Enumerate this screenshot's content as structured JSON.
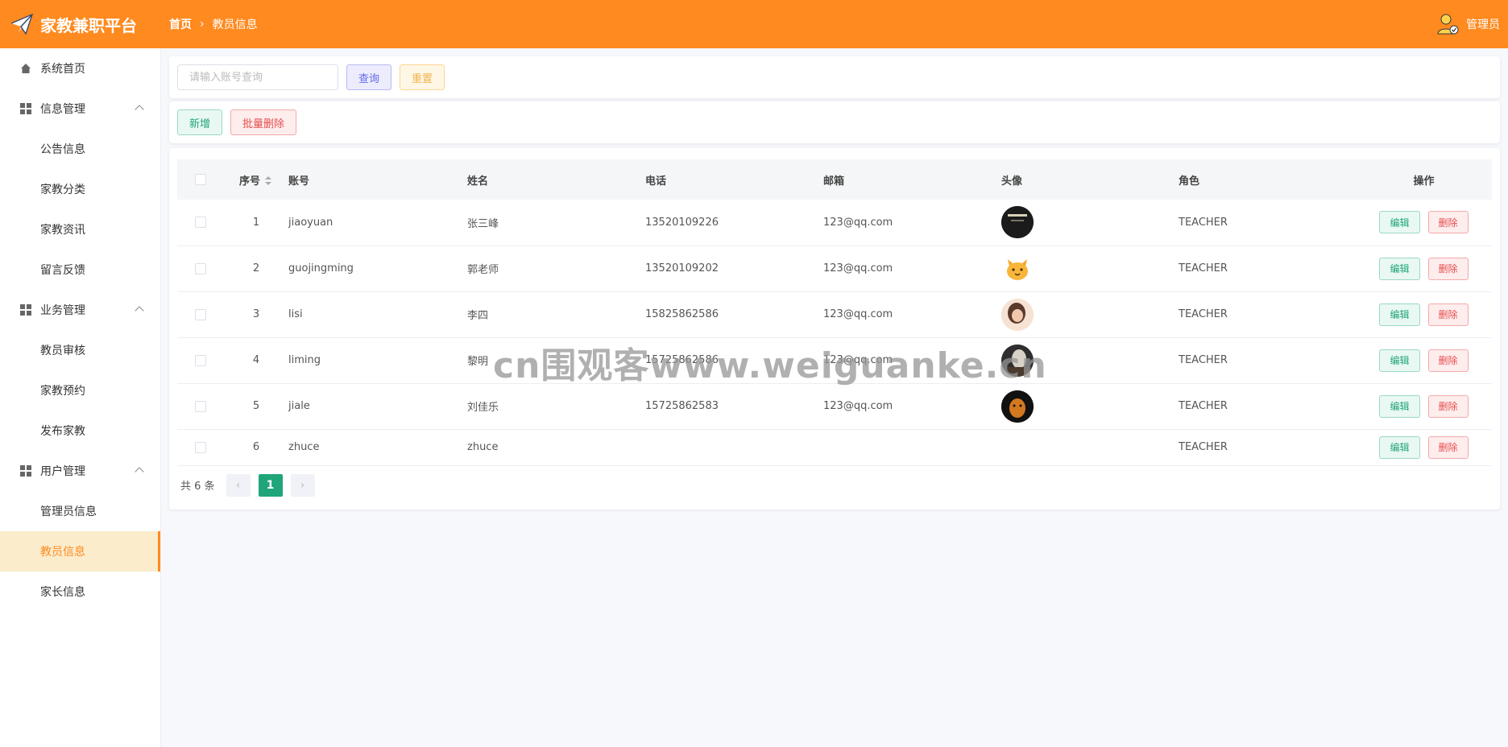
{
  "app": {
    "title": "家教兼职平台"
  },
  "breadcrumb": {
    "home": "首页",
    "separator": "›",
    "current": "教员信息"
  },
  "user": {
    "name": "管理员"
  },
  "sidebar": {
    "home": "系统首页",
    "groups": [
      {
        "label": "信息管理",
        "items": [
          "公告信息",
          "家教分类",
          "家教资讯",
          "留言反馈"
        ]
      },
      {
        "label": "业务管理",
        "items": [
          "教员审核",
          "家教预约",
          "发布家教"
        ]
      },
      {
        "label": "用户管理",
        "items": [
          "管理员信息",
          "教员信息",
          "家长信息"
        ]
      }
    ],
    "active": "教员信息"
  },
  "search": {
    "placeholder": "请输入账号查询",
    "query_label": "查询",
    "reset_label": "重置"
  },
  "actions": {
    "add_label": "新增",
    "batch_delete_label": "批量删除"
  },
  "table": {
    "headers": {
      "index": "序号",
      "account": "账号",
      "name": "姓名",
      "phone": "电话",
      "email": "邮箱",
      "avatar": "头像",
      "role": "角色",
      "ops": "操作"
    },
    "rows": [
      {
        "index": "1",
        "account": "jiaoyuan",
        "name": "张三峰",
        "phone": "13520109226",
        "email": "123@qq.com",
        "avatar": "dark-poster-avatar",
        "role": "TEACHER"
      },
      {
        "index": "2",
        "account": "guojingming",
        "name": "郭老师",
        "phone": "13520109202",
        "email": "123@qq.com",
        "avatar": "cat-emoji-avatar",
        "role": "TEACHER"
      },
      {
        "index": "3",
        "account": "lisi",
        "name": "李四",
        "phone": "15825862586",
        "email": "123@qq.com",
        "avatar": "girl-photo-avatar",
        "role": "TEACHER"
      },
      {
        "index": "4",
        "account": "liming",
        "name": "黎明",
        "phone": "15725862586",
        "email": "123@qq.com",
        "avatar": "mixed-photo-avatar",
        "role": "TEACHER"
      },
      {
        "index": "5",
        "account": "jiale",
        "name": "刘佳乐",
        "phone": "15725862583",
        "email": "123@qq.com",
        "avatar": "tiger-photo-avatar",
        "role": "TEACHER"
      },
      {
        "index": "6",
        "account": "zhuce",
        "name": "zhuce",
        "phone": "",
        "email": "",
        "avatar": "",
        "role": "TEACHER"
      }
    ],
    "edit_label": "编辑",
    "delete_label": "删除"
  },
  "pagination": {
    "total_text": "共 6 条",
    "current_page": "1",
    "prev": "‹",
    "next": "›"
  },
  "watermark": "cn围观客www.weiguanke.cn",
  "colors": {
    "brand": "#ff8a1f",
    "primary_green": "#1fa579",
    "danger": "#e84d4d",
    "active_bg": "#fbeccc"
  }
}
